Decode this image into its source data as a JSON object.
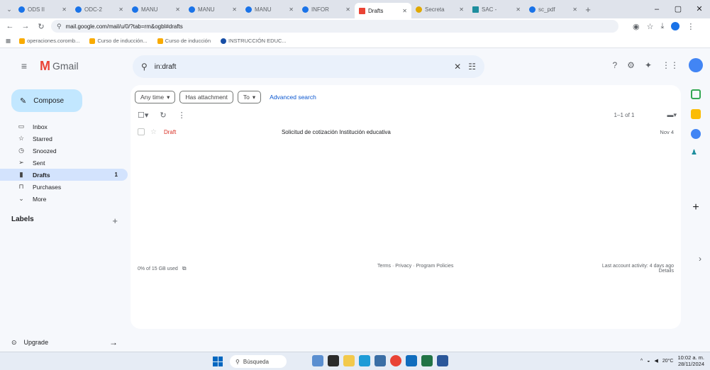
{
  "browser": {
    "tabs": [
      {
        "label": "ODS II",
        "active": false,
        "icon": "circle"
      },
      {
        "label": "ODC-2",
        "active": false,
        "icon": "circle"
      },
      {
        "label": "MANU",
        "active": false,
        "icon": "circle"
      },
      {
        "label": "MANU",
        "active": false,
        "icon": "circle"
      },
      {
        "label": "MANU",
        "active": false,
        "icon": "circle"
      },
      {
        "label": "INFOR",
        "active": false,
        "icon": "circle"
      },
      {
        "label": "Drafts",
        "active": true,
        "icon": "gmail"
      },
      {
        "label": "Secreta",
        "active": false,
        "icon": "gold"
      },
      {
        "label": "SAC -",
        "active": false,
        "icon": "teal"
      },
      {
        "label": "sc_pdf",
        "active": false,
        "icon": "circle"
      }
    ],
    "url": "mail.google.com/mail/u/0/?tab=rm&ogbl#drafts",
    "bookmarks": [
      {
        "label": "operaciones.coromb...",
        "icon": "y"
      },
      {
        "label": "Curso de inducción...",
        "icon": "y"
      },
      {
        "label": "Curso de inducción",
        "icon": "y"
      },
      {
        "label": "INSTRUCCIÓN EDUC...",
        "icon": "b"
      }
    ]
  },
  "gmail": {
    "app_name": "Gmail",
    "search": {
      "value": "in:draft"
    },
    "compose_label": "Compose",
    "nav": [
      {
        "label": "Inbox",
        "icon": "inbox-icon",
        "glyph": "▭",
        "count": "",
        "active": false
      },
      {
        "label": "Starred",
        "icon": "star-icon",
        "glyph": "☆",
        "count": "",
        "active": false
      },
      {
        "label": "Snoozed",
        "icon": "clock-icon",
        "glyph": "◷",
        "count": "",
        "active": false
      },
      {
        "label": "Sent",
        "icon": "send-icon",
        "glyph": "➢",
        "count": "",
        "active": false
      },
      {
        "label": "Drafts",
        "icon": "draft-icon",
        "glyph": "▮",
        "count": "1",
        "active": true
      },
      {
        "label": "Purchases",
        "icon": "purchases-icon",
        "glyph": "⊓",
        "count": "",
        "active": false
      },
      {
        "label": "More",
        "icon": "chevron-down-icon",
        "glyph": "⌄",
        "count": "",
        "active": false
      }
    ],
    "labels_heading": "Labels",
    "upgrade_label": "Upgrade",
    "filters": {
      "any_time": "Any time",
      "has_attachment": "Has attachment",
      "to": "To",
      "advanced_search": "Advanced search"
    },
    "messages": [
      {
        "sender": "Draft",
        "subject": "Solicitud de cotización Institución educativa",
        "date": "Nov 4"
      }
    ],
    "pager": "1–1 of 1",
    "footer": {
      "storage": "0% of 15 GB used",
      "terms": "Terms · Privacy · Program Policies",
      "activity": "Last account activity: 4 days ago",
      "details": "Details"
    }
  },
  "taskbar": {
    "search_label": "Búsqueda",
    "weather": "20°C",
    "time": "10:02 a. m.",
    "date": "28/11/2024"
  }
}
